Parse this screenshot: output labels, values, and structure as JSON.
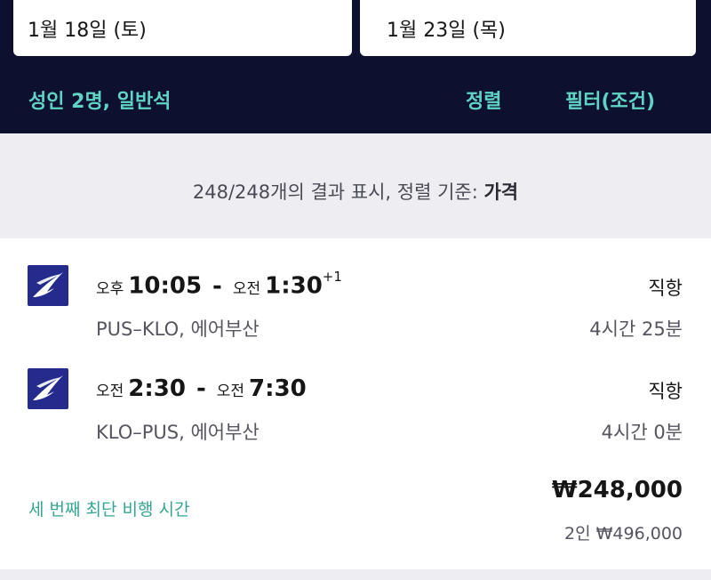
{
  "search": {
    "depart_date": "1월 18일 (토)",
    "return_date": "1월 23일 (목)",
    "passengers": "성인 2명, 일반석",
    "sort_label": "정렬",
    "filter_label": "필터(조건)"
  },
  "summary": {
    "text": "248/248개의 결과 표시, 정렬 기준: ",
    "sort_key": "가격"
  },
  "result": {
    "airline_logo_icon": "air-busan-logo-icon",
    "brand_color": "#242b8c",
    "outbound": {
      "dep_ampm": "오후",
      "dep_time": "10:05",
      "arr_ampm": "오전",
      "arr_time": "1:30",
      "day_offset": "+1",
      "route": "PUS–KLO, 에어부산",
      "stops": "직항",
      "duration": "4시간 25분"
    },
    "inbound": {
      "dep_ampm": "오전",
      "dep_time": "2:30",
      "arr_ampm": "오전",
      "arr_time": "7:30",
      "route": "KLO–PUS, 에어부산",
      "stops": "직항",
      "duration": "4시간 0분"
    },
    "tag": "세 번째 최단 비행 시간",
    "price": "₩248,000",
    "total_price": "2인 ₩496,000"
  },
  "colors": {
    "header_bg": "#0e1030",
    "accent": "#5fd4c4",
    "tag": "#35a593"
  }
}
